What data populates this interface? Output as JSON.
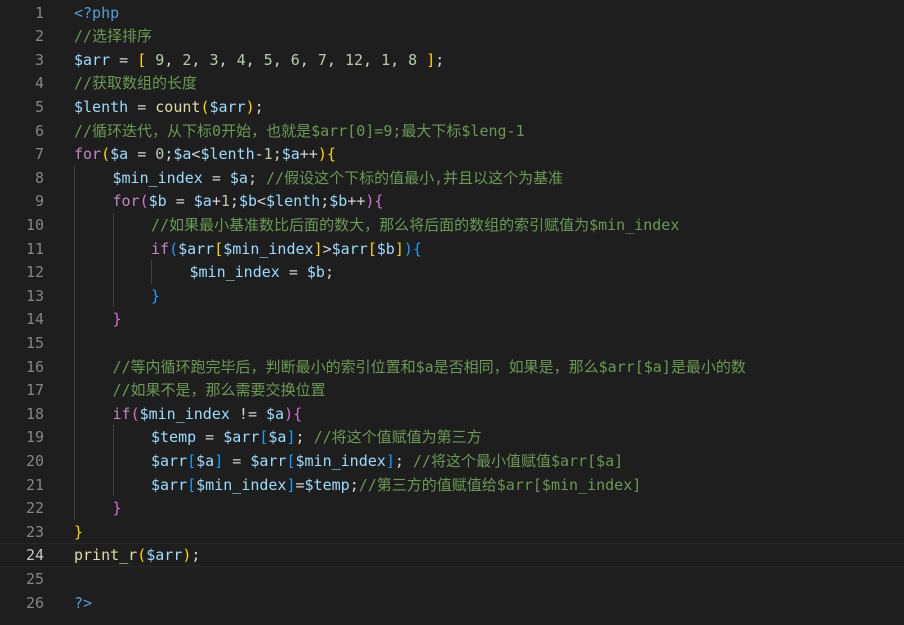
{
  "editor": {
    "language": "php",
    "current_line": 24,
    "colors": {
      "background": "#1e1e1e",
      "keyword": "#c586c0",
      "variable": "#9cdcfe",
      "function": "#dcdcaa",
      "number": "#b5cea8",
      "comment": "#6a9955",
      "tag": "#569cd6",
      "bracket_level_1": "#ffd700",
      "bracket_level_2": "#da70d6",
      "bracket_level_3": "#179fff"
    },
    "lines": [
      {
        "no": "1",
        "indent": 0,
        "tokens": [
          [
            "tag",
            "<?php"
          ]
        ]
      },
      {
        "no": "2",
        "indent": 0,
        "tokens": [
          [
            "cmt",
            "//选择排序"
          ]
        ]
      },
      {
        "no": "3",
        "indent": 0,
        "tokens": [
          [
            "var",
            "$arr"
          ],
          [
            "op",
            " = "
          ],
          [
            "b1",
            "["
          ],
          [
            "op",
            " "
          ],
          [
            "num",
            "9"
          ],
          [
            "op",
            ", "
          ],
          [
            "num",
            "2"
          ],
          [
            "op",
            ", "
          ],
          [
            "num",
            "3"
          ],
          [
            "op",
            ", "
          ],
          [
            "num",
            "4"
          ],
          [
            "op",
            ", "
          ],
          [
            "num",
            "5"
          ],
          [
            "op",
            ", "
          ],
          [
            "num",
            "6"
          ],
          [
            "op",
            ", "
          ],
          [
            "num",
            "7"
          ],
          [
            "op",
            ", "
          ],
          [
            "num",
            "12"
          ],
          [
            "op",
            ", "
          ],
          [
            "num",
            "1"
          ],
          [
            "op",
            ", "
          ],
          [
            "num",
            "8"
          ],
          [
            "op",
            " "
          ],
          [
            "b1",
            "]"
          ],
          [
            "op",
            ";"
          ]
        ]
      },
      {
        "no": "4",
        "indent": 0,
        "tokens": [
          [
            "cmt",
            "//获取数组的长度"
          ]
        ]
      },
      {
        "no": "5",
        "indent": 0,
        "tokens": [
          [
            "var",
            "$lenth"
          ],
          [
            "op",
            " = "
          ],
          [
            "fn",
            "count"
          ],
          [
            "b1",
            "("
          ],
          [
            "var",
            "$arr"
          ],
          [
            "b1",
            ")"
          ],
          [
            "op",
            ";"
          ]
        ]
      },
      {
        "no": "6",
        "indent": 0,
        "tokens": [
          [
            "cmt",
            "//循环迭代，从下标0开始，也就是$arr[0]=9;最大下标$leng-1"
          ]
        ]
      },
      {
        "no": "7",
        "indent": 0,
        "tokens": [
          [
            "kw",
            "for"
          ],
          [
            "b1",
            "("
          ],
          [
            "var",
            "$a"
          ],
          [
            "op",
            " = "
          ],
          [
            "num",
            "0"
          ],
          [
            "op",
            ";"
          ],
          [
            "var",
            "$a"
          ],
          [
            "op",
            "<"
          ],
          [
            "var",
            "$lenth"
          ],
          [
            "op",
            "-"
          ],
          [
            "num",
            "1"
          ],
          [
            "op",
            ";"
          ],
          [
            "var",
            "$a"
          ],
          [
            "op",
            "++"
          ],
          [
            "b1",
            ")"
          ],
          [
            "b1",
            "{"
          ]
        ]
      },
      {
        "no": "8",
        "indent": 1,
        "tokens": [
          [
            "var",
            "$min_index"
          ],
          [
            "op",
            " = "
          ],
          [
            "var",
            "$a"
          ],
          [
            "op",
            "; "
          ],
          [
            "cmt",
            "//假设这个下标的值最小,并且以这个为基准"
          ]
        ]
      },
      {
        "no": "9",
        "indent": 1,
        "tokens": [
          [
            "kw",
            "for"
          ],
          [
            "b2",
            "("
          ],
          [
            "var",
            "$b"
          ],
          [
            "op",
            " = "
          ],
          [
            "var",
            "$a"
          ],
          [
            "op",
            "+"
          ],
          [
            "num",
            "1"
          ],
          [
            "op",
            ";"
          ],
          [
            "var",
            "$b"
          ],
          [
            "op",
            "<"
          ],
          [
            "var",
            "$lenth"
          ],
          [
            "op",
            ";"
          ],
          [
            "var",
            "$b"
          ],
          [
            "op",
            "++"
          ],
          [
            "b2",
            ")"
          ],
          [
            "b2",
            "{"
          ]
        ]
      },
      {
        "no": "10",
        "indent": 2,
        "tokens": [
          [
            "cmt",
            "//如果最小基准数比后面的数大，那么将后面的数组的索引赋值为$min_index"
          ]
        ]
      },
      {
        "no": "11",
        "indent": 2,
        "tokens": [
          [
            "kw",
            "if"
          ],
          [
            "b3",
            "("
          ],
          [
            "var",
            "$arr"
          ],
          [
            "b1",
            "["
          ],
          [
            "var",
            "$min_index"
          ],
          [
            "b1",
            "]"
          ],
          [
            "op",
            ">"
          ],
          [
            "var",
            "$arr"
          ],
          [
            "b1",
            "["
          ],
          [
            "var",
            "$b"
          ],
          [
            "b1",
            "]"
          ],
          [
            "b3",
            ")"
          ],
          [
            "b3",
            "{"
          ]
        ]
      },
      {
        "no": "12",
        "indent": 3,
        "tokens": [
          [
            "var",
            "$min_index"
          ],
          [
            "op",
            " = "
          ],
          [
            "var",
            "$b"
          ],
          [
            "op",
            ";"
          ]
        ]
      },
      {
        "no": "13",
        "indent": 2,
        "tokens": [
          [
            "b3",
            "}"
          ]
        ]
      },
      {
        "no": "14",
        "indent": 1,
        "tokens": [
          [
            "b2",
            "}"
          ]
        ]
      },
      {
        "no": "15",
        "indent": 0,
        "tokens": []
      },
      {
        "no": "16",
        "indent": 1,
        "tokens": [
          [
            "cmt",
            "//等内循环跑完毕后，判断最小的索引位置和$a是否相同，如果是，那么$arr[$a]是最小的数"
          ]
        ]
      },
      {
        "no": "17",
        "indent": 1,
        "tokens": [
          [
            "cmt",
            "//如果不是，那么需要交换位置"
          ]
        ]
      },
      {
        "no": "18",
        "indent": 1,
        "tokens": [
          [
            "kw",
            "if"
          ],
          [
            "b2",
            "("
          ],
          [
            "var",
            "$min_index"
          ],
          [
            "op",
            " != "
          ],
          [
            "var",
            "$a"
          ],
          [
            "b2",
            ")"
          ],
          [
            "b2",
            "{"
          ]
        ]
      },
      {
        "no": "19",
        "indent": 2,
        "tokens": [
          [
            "var",
            "$temp"
          ],
          [
            "op",
            " = "
          ],
          [
            "var",
            "$arr"
          ],
          [
            "b3",
            "["
          ],
          [
            "var",
            "$a"
          ],
          [
            "b3",
            "]"
          ],
          [
            "op",
            "; "
          ],
          [
            "cmt",
            "//将这个值赋值为第三方"
          ]
        ]
      },
      {
        "no": "20",
        "indent": 2,
        "tokens": [
          [
            "var",
            "$arr"
          ],
          [
            "b3",
            "["
          ],
          [
            "var",
            "$a"
          ],
          [
            "b3",
            "]"
          ],
          [
            "op",
            " = "
          ],
          [
            "var",
            "$arr"
          ],
          [
            "b3",
            "["
          ],
          [
            "var",
            "$min_index"
          ],
          [
            "b3",
            "]"
          ],
          [
            "op",
            "; "
          ],
          [
            "cmt",
            "//将这个最小值赋值$arr[$a]"
          ]
        ]
      },
      {
        "no": "21",
        "indent": 2,
        "tokens": [
          [
            "var",
            "$arr"
          ],
          [
            "b3",
            "["
          ],
          [
            "var",
            "$min_index"
          ],
          [
            "b3",
            "]"
          ],
          [
            "op",
            "="
          ],
          [
            "var",
            "$temp"
          ],
          [
            "op",
            ";"
          ],
          [
            "cmt",
            "//第三方的值赋值给$arr[$min_index]"
          ]
        ]
      },
      {
        "no": "22",
        "indent": 1,
        "tokens": [
          [
            "b2",
            "}"
          ]
        ]
      },
      {
        "no": "23",
        "indent": 0,
        "tokens": [
          [
            "b1",
            "}"
          ]
        ]
      },
      {
        "no": "24",
        "indent": 0,
        "tokens": [
          [
            "fn",
            "print_r"
          ],
          [
            "b1",
            "("
          ],
          [
            "var",
            "$arr"
          ],
          [
            "b1",
            ")"
          ],
          [
            "op",
            ";"
          ]
        ]
      },
      {
        "no": "25",
        "indent": 0,
        "tokens": []
      },
      {
        "no": "26",
        "indent": 0,
        "tokens": [
          [
            "tag",
            "?>"
          ]
        ]
      }
    ]
  }
}
